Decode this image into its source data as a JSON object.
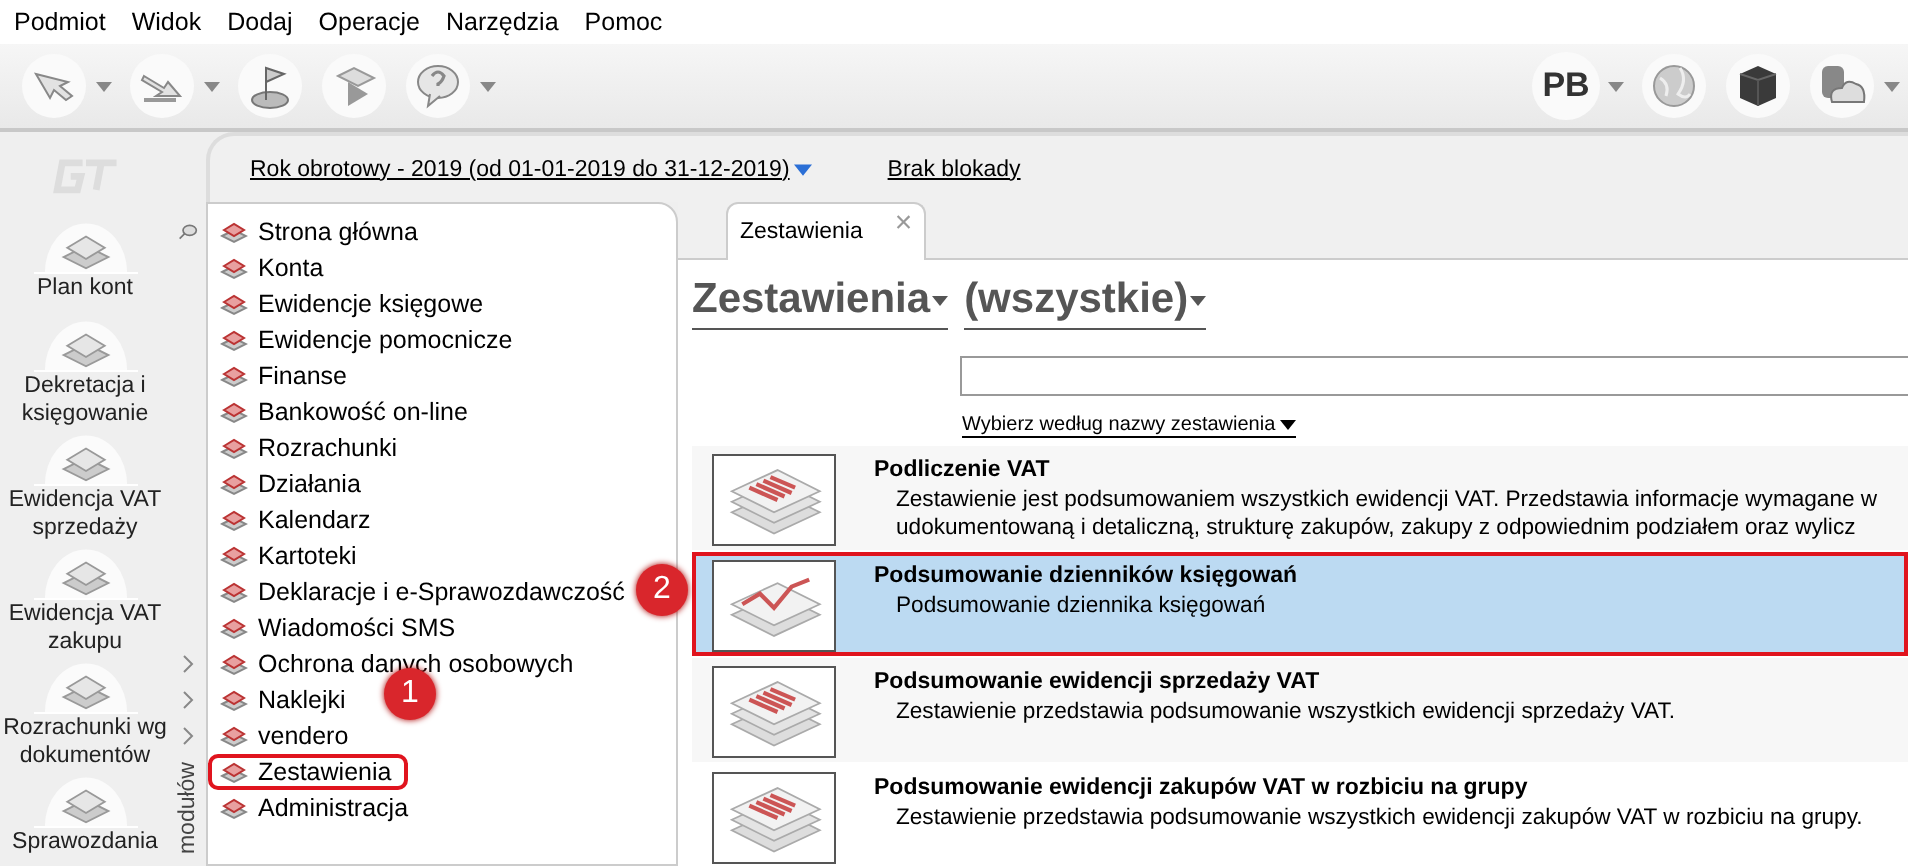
{
  "menu": [
    "Podmiot",
    "Widok",
    "Dodaj",
    "Operacje",
    "Narzędzia",
    "Pomoc"
  ],
  "toolbar_left": [
    {
      "caret": true
    },
    {
      "caret": true
    },
    {
      "caret": false
    },
    {
      "caret": false
    },
    {
      "caret": true
    }
  ],
  "toolbar_right": [
    {
      "label": "PB",
      "caret": true
    },
    {
      "caret": false
    },
    {
      "caret": false
    },
    {
      "caret": true
    }
  ],
  "header": {
    "fiscal_year": "Rok obrotowy - 2019  (od 01-01-2019 do 31-12-2019)",
    "lock": "Brak blokady"
  },
  "shortcuts": [
    {
      "label": "Plan kont"
    },
    {
      "label": "Dekretacja i księgowanie"
    },
    {
      "label": "Ewidencja VAT sprzedaży"
    },
    {
      "label": "Ewidencja VAT zakupu"
    },
    {
      "label": "Rozrachunki wg dokumentów"
    },
    {
      "label": "Sprawozdania"
    }
  ],
  "modules_caption": "modułów",
  "modules": [
    {
      "label": "Strona główna",
      "selected": false,
      "expandable": false
    },
    {
      "label": "Konta",
      "selected": false,
      "expandable": false
    },
    {
      "label": "Ewidencje księgowe",
      "selected": false,
      "expandable": false
    },
    {
      "label": "Ewidencje pomocnicze",
      "selected": false,
      "expandable": false
    },
    {
      "label": "Finanse",
      "selected": false,
      "expandable": false
    },
    {
      "label": "Bankowość on-line",
      "selected": false,
      "expandable": false
    },
    {
      "label": "Rozrachunki",
      "selected": false,
      "expandable": false
    },
    {
      "label": "Działania",
      "selected": false,
      "expandable": false
    },
    {
      "label": "Kalendarz",
      "selected": false,
      "expandable": false
    },
    {
      "label": "Kartoteki",
      "selected": false,
      "expandable": false
    },
    {
      "label": "Deklaracje i e-Sprawozdawczość",
      "selected": false,
      "expandable": false
    },
    {
      "label": "Wiadomości SMS",
      "selected": false,
      "expandable": false
    },
    {
      "label": "Ochrona danych osobowych",
      "selected": false,
      "expandable": true
    },
    {
      "label": "Naklejki",
      "selected": false,
      "expandable": true
    },
    {
      "label": "vendero",
      "selected": false,
      "expandable": true
    },
    {
      "label": "Zestawienia",
      "selected": true,
      "expandable": false
    },
    {
      "label": "Administracja",
      "selected": false,
      "expandable": false
    }
  ],
  "tab": {
    "label": "Zestawienia",
    "close": "×"
  },
  "title": "Zestawienia",
  "filter": "(wszystkie)",
  "search": {
    "link": "Wybierz według nazwy zestawienia"
  },
  "reports": [
    {
      "kind": "list",
      "title": "Podliczenie VAT",
      "desc": [
        "Zestawienie jest podsumowaniem wszystkich ewidencji VAT. Przedstawia informacje wymagane w",
        "udokumentowaną i detaliczną, strukturę zakupów, zakupy z odpowiednim podziałem oraz wylicz"
      ],
      "selected": false
    },
    {
      "kind": "chart",
      "title": "Podsumowanie dzienników księgowań",
      "desc": [
        "Podsumowanie dziennika księgowań"
      ],
      "selected": true
    },
    {
      "kind": "list",
      "title": "Podsumowanie ewidencji sprzedaży VAT",
      "desc": [
        "Zestawienie przedstawia podsumowanie wszystkich ewidencji sprzedaży VAT."
      ],
      "selected": false
    },
    {
      "kind": "list",
      "title": "Podsumowanie ewidencji zakupów VAT w rozbiciu na grupy",
      "desc": [
        "Zestawienie przedstawia podsumowanie wszystkich ewidencji zakupów VAT w rozbiciu na grupy."
      ],
      "selected": false
    }
  ],
  "callouts": [
    "1",
    "2"
  ]
}
